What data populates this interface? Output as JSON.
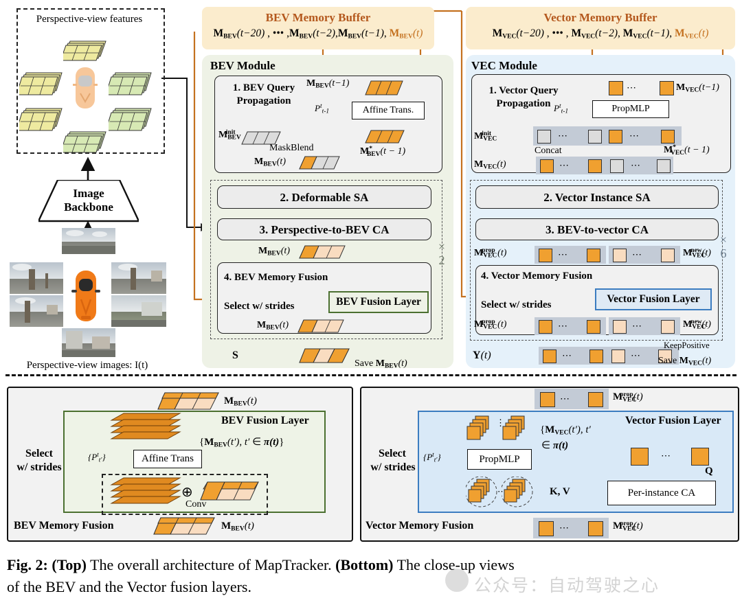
{
  "figure": {
    "caption_line1_bold1": "Fig. 2: (Top)",
    "caption_line1_rest": " The overall architecture of MapTracker. ",
    "caption_line1_bold2": "(Bottom)",
    "caption_line1_tail": " The close-up views",
    "caption_line2": "of the BEV and the Vector fusion layers.",
    "watermark": "公众号：自动驾驶之心"
  },
  "left_column": {
    "pv_features_title": "Perspective-view features",
    "backbone_label_line1": "Image",
    "backbone_label_line2": "Backbone",
    "pv_images_label": "Perspective-view images: I(t)"
  },
  "bev_buffer": {
    "title": "BEV Memory Buffer",
    "items": [
      "M",
      "BEV",
      "(t − 20)",
      ", ••• ,",
      "M",
      "BEV",
      "(t − 2)",
      ",",
      "M",
      "BEV",
      "(t − 1)",
      ",",
      "M",
      "BEV",
      "(t)"
    ],
    "text": "M_BEV(t-20) , ••• , M_BEV(t-2), M_BEV(t-1), M_BEV(t)",
    "highlight_color": "#c4711f"
  },
  "vec_buffer": {
    "title": "Vector Memory Buffer",
    "text": "M_VEC(t-20) , ••• , M_VEC(t-2), M_VEC(t-1), M_VEC(t)",
    "highlight_color": "#c4711f"
  },
  "bev_module": {
    "title": "BEV Module",
    "repeat": "× 2",
    "step1": {
      "title_line1": "1. BEV Query",
      "title_line2": "Propagation",
      "input_label": "M_BEV(t − 1)",
      "affine_box": "Affine Trans.",
      "pose_label": "P^t_{t-1}",
      "init_label": "M^init_BEV",
      "maskblend": "MaskBlend",
      "star_label": "M*_BEV(t − 1)",
      "output_label": "M_BEV(t)"
    },
    "step2": "2. Deformable SA",
    "step3": "3. Perspective-to-BEV CA",
    "mid_label": "M_BEV(t)",
    "step4": {
      "title": "4. BEV Memory Fusion",
      "select": "Select w/ strides",
      "fusion_layer": "BEV Fusion Layer",
      "output_label": "M_BEV(t)"
    },
    "output_symbol": "S",
    "save_label": "Save M_BEV(t)"
  },
  "vec_module": {
    "title": "VEC Module",
    "repeat": "× 6",
    "step1": {
      "title_line1": "1. Vector Query",
      "title_line2": "Propagation",
      "input_label": "M_VEC(t − 1)",
      "prop_box": "PropMLP",
      "pose_label": "P^t_{t-1}",
      "init_label": "M^init_VEC",
      "concat": "Concat",
      "star_label": "M*_VEC(t − 1)",
      "output_label": "M_VEC(t)"
    },
    "step2": "2. Vector Instance SA",
    "step3": "3. BEV-to-vector CA",
    "prop_label": "M^prop_VEC(t)",
    "new_label": "M^new_VEC(t)",
    "step4": {
      "title": "4. Vector Memory Fusion",
      "select": "Select w/ strides",
      "fusion_layer": "Vector Fusion Layer",
      "prop_label": "M^prop_VEC(t)",
      "new_label": "M^new_VEC(t)"
    },
    "output_symbol": "Y(t)",
    "keep_positive": "KeepPositive",
    "save_label": "Save M_VEC(t)"
  },
  "bottom_left": {
    "panel_title": "BEV Memory Fusion",
    "input_label": "M_BEV(t)",
    "inner_title": "BEV Fusion Layer",
    "select_line1": "Select",
    "select_line2": "w/ strides",
    "pose_set": "{P^t_{t'}}",
    "affine_box": "Affine Trans",
    "set_label": "{M_BEV(t'), t' ∈ π(t)}",
    "plus_symbol": "⊕",
    "conv_label": "Conv",
    "output_label": "M_BEV(t)"
  },
  "bottom_right": {
    "panel_title": "Vector Memory Fusion",
    "input_label": "M^prop_VEC(t)",
    "inner_title": "Vector Fusion Layer",
    "select_line1": "Select",
    "select_line2": "w/ strides",
    "pose_set": "{P^t_{t'}}",
    "prop_box": "PropMLP",
    "set_label_l1": "{M_VEC(t'), t'",
    "set_label_l2": "∈ π(t)}",
    "q_label": "Q",
    "kv_label": "K, V",
    "ca_box": "Per-instance CA",
    "output_label": "M^prop_VEC(t)"
  },
  "colors": {
    "orange_accent": "#c4711f",
    "orange_tile": "#f0a030",
    "pale_tile": "#f9dcc0",
    "grey_tile": "#dcdcdc",
    "bev_green": "#4b7030",
    "vec_blue": "#3b7cc0",
    "bev_panel_bg": "#eef2e6",
    "vec_panel_bg": "#e5f1fa",
    "buffer_bg": "#fbeccd"
  }
}
